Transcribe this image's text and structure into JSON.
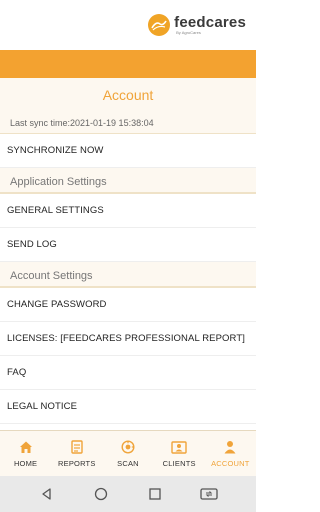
{
  "brand": {
    "name": "feedcares",
    "sub": "By AgroCares",
    "color": "#f0a426"
  },
  "header": {
    "title": "Account"
  },
  "sync": {
    "text": "Last sync time:2021-01-19 15:38:04"
  },
  "items": {
    "synchronize": "SYNCHRONIZE NOW",
    "general_settings": "GENERAL SETTINGS",
    "send_log": "SEND LOG",
    "change_password": "CHANGE PASSWORD",
    "licenses": "LICENSES: [FEEDCARES PROFESSIONAL REPORT]",
    "faq": "FAQ",
    "legal_notice": "LEGAL NOTICE"
  },
  "sections": {
    "application": "Application Settings",
    "account": "Account Settings"
  },
  "nav": {
    "home": "HOME",
    "reports": "REPORTS",
    "scan": "SCAN",
    "clients": "CLIENTS",
    "account": "ACCOUNT",
    "active": "account",
    "icon_color": "#f0a43a"
  },
  "colors": {
    "accent": "#f3a230",
    "band_bg": "#fdf8f0"
  }
}
